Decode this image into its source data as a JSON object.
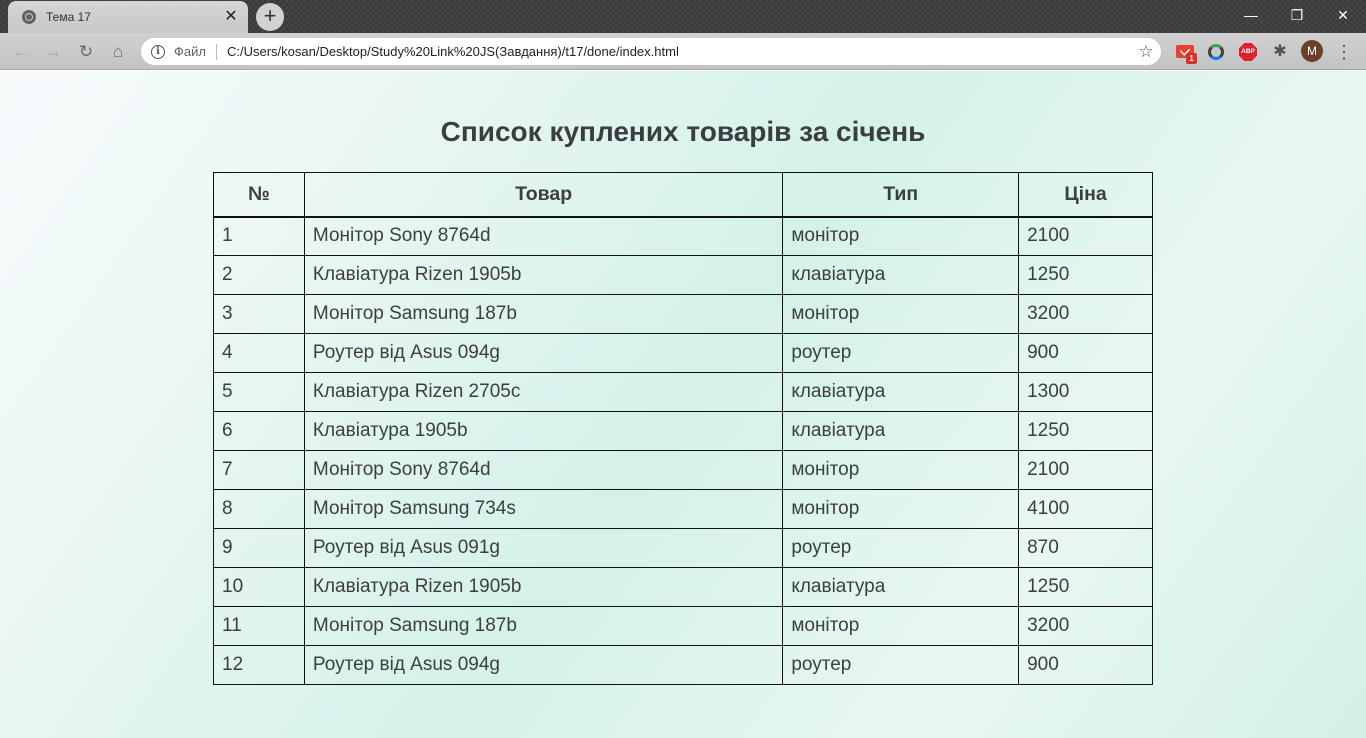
{
  "browser": {
    "tab_title": "Тема 17",
    "tab_close": "✕",
    "new_tab": "+",
    "window_controls": {
      "minimize": "—",
      "maximize": "❐",
      "close": "✕"
    },
    "nav": {
      "back": "←",
      "forward": "→",
      "reload": "↻",
      "home": "⌂"
    },
    "scheme_label": "Файл",
    "url": "C:/Users/kosan/Desktop/Study%20Link%20JS(Завдання)/t17/done/index.html",
    "star": "☆",
    "extensions": {
      "gmail_badge": "1",
      "abp_label": "ABP",
      "puzzle": "✱"
    },
    "avatar_letter": "M",
    "menu": "⋮"
  },
  "page": {
    "title": "Список куплених товарів за січень",
    "table": {
      "headers": {
        "num": "№",
        "item": "Товар",
        "type": "Тип",
        "price": "Ціна"
      },
      "rows": [
        {
          "num": "1",
          "item": "Монітор Sony 8764d",
          "type": "монітор",
          "price": "2100"
        },
        {
          "num": "2",
          "item": "Клавіатура Rizen 1905b",
          "type": "клавіатура",
          "price": "1250"
        },
        {
          "num": "3",
          "item": "Монітор Samsung 187b",
          "type": "монітор",
          "price": "3200"
        },
        {
          "num": "4",
          "item": "Роутер від Asus 094g",
          "type": "роутер",
          "price": "900"
        },
        {
          "num": "5",
          "item": "Клавіатура Rizen 2705c",
          "type": "клавіатура",
          "price": "1300"
        },
        {
          "num": "6",
          "item": "Клавіатура 1905b",
          "type": "клавіатура",
          "price": "1250"
        },
        {
          "num": "7",
          "item": "Монітор Sony 8764d",
          "type": "монітор",
          "price": "2100"
        },
        {
          "num": "8",
          "item": "Монітор Samsung 734s",
          "type": "монітор",
          "price": "4100"
        },
        {
          "num": "9",
          "item": "Роутер від Asus 091g",
          "type": "роутер",
          "price": "870"
        },
        {
          "num": "10",
          "item": "Клавіатура Rizen 1905b",
          "type": "клавіатура",
          "price": "1250"
        },
        {
          "num": "11",
          "item": "Монітор Samsung 187b",
          "type": "монітор",
          "price": "3200"
        },
        {
          "num": "12",
          "item": "Роутер від Asus 094g",
          "type": "роутер",
          "price": "900"
        }
      ]
    }
  }
}
